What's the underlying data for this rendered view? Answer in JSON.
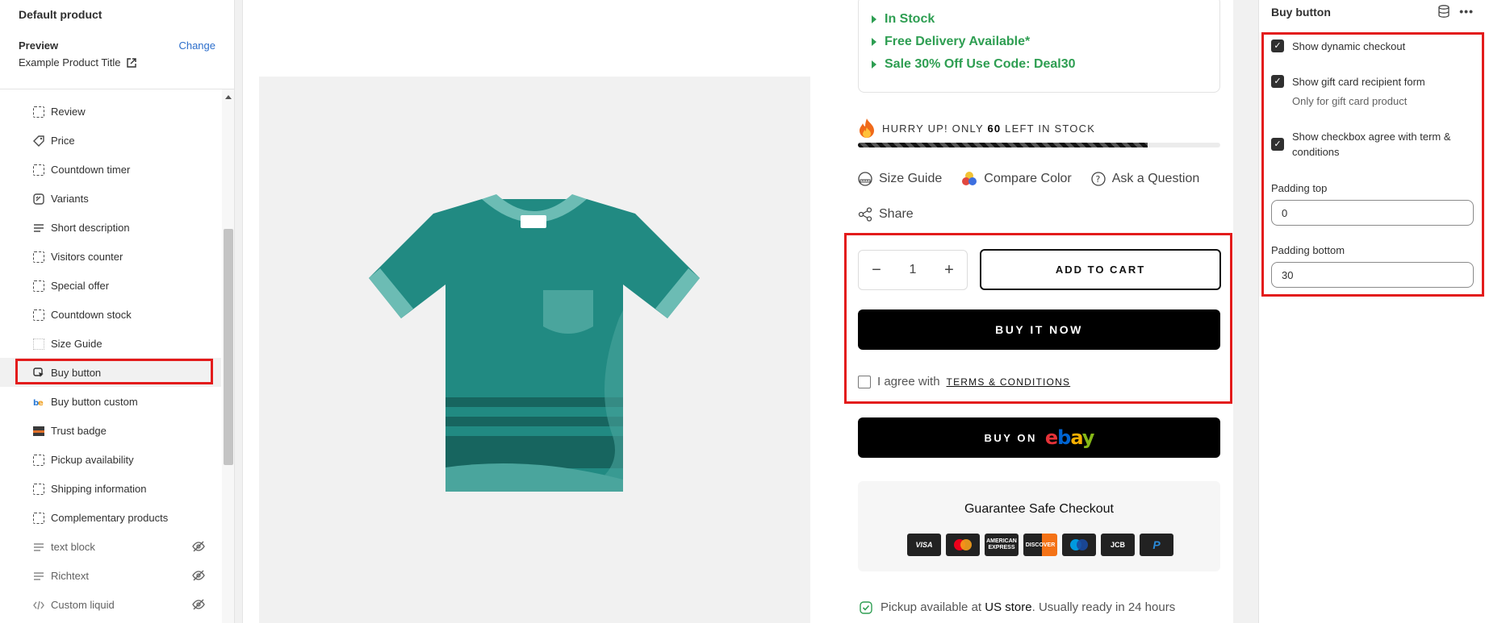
{
  "sidebar": {
    "title": "Default product",
    "preview_label": "Preview",
    "change_label": "Change",
    "product_title": "Example Product Title",
    "items": [
      {
        "label": "Review",
        "icon": "dashed-square-icon",
        "hidden": false
      },
      {
        "label": "Price",
        "icon": "price-tag-icon",
        "hidden": false
      },
      {
        "label": "Countdown timer",
        "icon": "dashed-square-icon",
        "hidden": false
      },
      {
        "label": "Variants",
        "icon": "variants-icon",
        "hidden": false
      },
      {
        "label": "Short description",
        "icon": "text-lines-icon",
        "hidden": false
      },
      {
        "label": "Visitors counter",
        "icon": "dashed-square-icon",
        "hidden": false
      },
      {
        "label": "Special offer",
        "icon": "dashed-square-icon",
        "hidden": false
      },
      {
        "label": "Countdown stock",
        "icon": "dashed-square-icon",
        "hidden": false
      },
      {
        "label": "Size Guide",
        "icon": "size-guide-icon",
        "hidden": false
      },
      {
        "label": "Buy button",
        "icon": "cursor-click-icon",
        "hidden": false,
        "selected": true
      },
      {
        "label": "Buy button custom",
        "icon": "app-block-icon",
        "hidden": false
      },
      {
        "label": "Trust badge",
        "icon": "badge-image-icon",
        "hidden": false
      },
      {
        "label": "Pickup availability",
        "icon": "dashed-square-icon",
        "hidden": false
      },
      {
        "label": "Shipping information",
        "icon": "dashed-square-icon",
        "hidden": false
      },
      {
        "label": "Complementary products",
        "icon": "dashed-square-icon",
        "hidden": false
      },
      {
        "label": "text block",
        "icon": "text-lines-icon",
        "hidden": true
      },
      {
        "label": "Richtext",
        "icon": "text-lines-icon",
        "hidden": true
      },
      {
        "label": "Custom liquid",
        "icon": "code-icon",
        "hidden": true
      }
    ]
  },
  "product": {
    "info": [
      "In Stock",
      "Free Delivery Available*",
      "Sale 30% Off Use Code: Deal30"
    ],
    "hurry_prefix": "HURRY UP! ONLY",
    "hurry_count": "60",
    "hurry_suffix": "LEFT IN STOCK",
    "stock_fraction": 0.8,
    "tools": {
      "size_guide": "Size Guide",
      "compare_color": "Compare Color",
      "ask": "Ask a Question",
      "share": "Share"
    },
    "quantity": "1",
    "add_to_cart": "ADD TO CART",
    "buy_now": "BUY IT NOW",
    "agree_text": "I agree with",
    "terms": "TERMS & CONDITIONS",
    "buy_on": "BUY ON",
    "ebay": "ebay",
    "guarantee": "Guarantee Safe Checkout",
    "payments": [
      "VISA",
      "MC",
      "AMEX",
      "DISCOVER",
      "MAESTRO",
      "JCB",
      "PAYPAL"
    ],
    "pickup_prefix": "Pickup available at",
    "pickup_store": "US store",
    "pickup_suffix": ". Usually ready in 24 hours"
  },
  "settings": {
    "title": "Buy button",
    "show_dynamic_checkout": "Show dynamic checkout",
    "show_gift_card": "Show gift card recipient form",
    "gift_card_note": "Only for gift card product",
    "show_agree": "Show checkbox agree with term & conditions",
    "padding_top_label": "Padding top",
    "padding_top": "0",
    "padding_bottom_label": "Padding bottom",
    "padding_bottom": "30"
  },
  "colors": {
    "accent_red": "#e31b1b",
    "stock_green": "#2e9e52",
    "link_blue": "#2c6ecb",
    "tshirt": "#218a82"
  }
}
